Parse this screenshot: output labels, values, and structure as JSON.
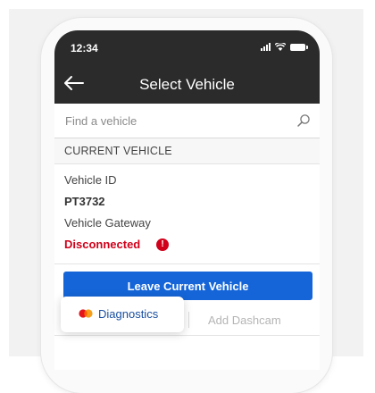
{
  "status_bar": {
    "time": "12:34"
  },
  "header": {
    "title": "Select Vehicle"
  },
  "search": {
    "placeholder": "Find a vehicle"
  },
  "current_vehicle": {
    "section_label": "CURRENT VEHICLE",
    "id_label": "Vehicle ID",
    "id_value": "PT3732",
    "gateway_label": "Vehicle Gateway",
    "gateway_status": "Disconnected",
    "status_color": "#d0021b"
  },
  "actions": {
    "leave_label": "Leave Current Vehicle",
    "accent": "#1565d8"
  },
  "tabs": {
    "diagnostics": "Diagnostics",
    "dashcam": "Add Dashcam"
  },
  "icons": [
    "arrow-left-icon",
    "search-icon",
    "alert-icon",
    "diagnostics-logo-icon",
    "signal-icon",
    "wifi-icon",
    "battery-icon"
  ]
}
